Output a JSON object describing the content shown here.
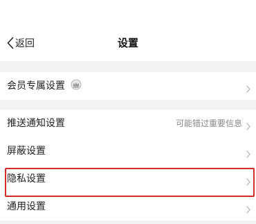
{
  "nav": {
    "back_label": "返回",
    "title": "设置",
    "back_icon": "chevron-left-icon"
  },
  "member_section": {
    "items": [
      {
        "label": "会员专属设置",
        "icon": "crown-badge-icon"
      }
    ]
  },
  "settings_section": {
    "items": [
      {
        "label": "推送通知设置",
        "value": "可能错过重要信息"
      },
      {
        "label": "屏蔽设置"
      },
      {
        "label": "隐私设置",
        "highlighted": true
      },
      {
        "label": "通用设置"
      }
    ]
  },
  "colors": {
    "highlight": "#d42a2a",
    "background": "#f2f2f2",
    "secondary_text": "#888888"
  }
}
